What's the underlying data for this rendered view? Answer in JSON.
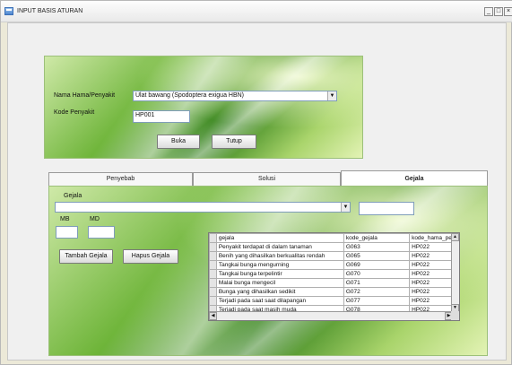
{
  "window": {
    "title": "INPUT BASIS ATURAN",
    "min": "_",
    "max": "□",
    "close": "×"
  },
  "top": {
    "hama_label": "Nama Hama/Penyakit",
    "hama_value": "Ulat bawang (Spodoptera exigua HBN)",
    "kode_label": "Kode Penyakit",
    "kode_value": "HP001",
    "buka": "Buka",
    "tutup": "Tutup"
  },
  "tabs": [
    "Penyebab",
    "Solusi",
    "Gejala"
  ],
  "gejala": {
    "label": "Gejala",
    "select_value": "",
    "code_value": "",
    "mb_label": "MB",
    "md_label": "MD",
    "mb_value": "",
    "md_value": "",
    "tambah": "Tambah Gejala",
    "hapus": "Hapus Gejala"
  },
  "grid": {
    "headers": [
      "gejala",
      "kode_gejala",
      "kode_hama_pen"
    ],
    "rows": [
      [
        "Penyakit terdapat di dalam tanaman",
        "G063",
        "HP022"
      ],
      [
        "Benih yang dihasilkan berkualitas rendah",
        "G065",
        "HP022"
      ],
      [
        "Tangkai bunga mengurning",
        "G069",
        "HP022"
      ],
      [
        "Tangkai bunga terpelintir",
        "G070",
        "HP022"
      ],
      [
        "Malai bunga mengecil",
        "G071",
        "HP022"
      ],
      [
        "Bunga yang dihasilkan sedikit",
        "G072",
        "HP022"
      ],
      [
        "Terjadi pada saat saat dilapangan",
        "G077",
        "HP022"
      ],
      [
        "Terjadi pada saat masih muda",
        "G078",
        "HP022"
      ]
    ]
  }
}
